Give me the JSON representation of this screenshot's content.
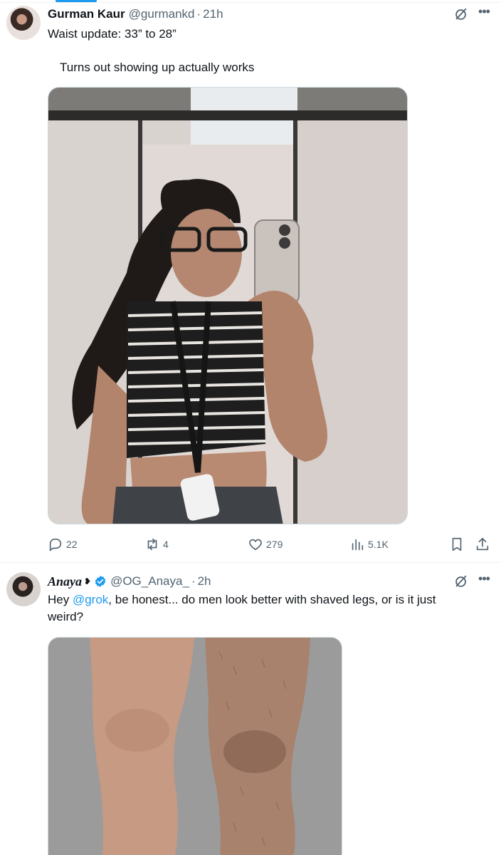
{
  "tweets": [
    {
      "author": {
        "name": "Gurman Kaur",
        "handle": "@gurmankd",
        "time": "21h"
      },
      "text_line_1": "Waist update: 33” to 28”",
      "text_line_2": "Turns out showing up actually works",
      "actions": {
        "replies": "22",
        "reposts": "4",
        "likes": "279",
        "views": "5.1K"
      }
    },
    {
      "author": {
        "name": "Anaya",
        "badge": "❥",
        "verified": true,
        "handle": "@OG_Anaya_",
        "time": "2h"
      },
      "text_prefix": "Hey ",
      "mention": "@grok",
      "text_suffix": ", be honest... do men look better with shaved legs, or is it just weird?"
    }
  ],
  "separator": "·",
  "more_glyph": "•••",
  "colors": {
    "accent": "#1d9bf0",
    "muted": "#536471",
    "text": "#0f1419",
    "border": "#eff3f4"
  },
  "icons": [
    "grok-icon",
    "more-icon",
    "reply-icon",
    "repost-icon",
    "like-icon",
    "views-icon",
    "bookmark-icon",
    "share-icon",
    "verified-icon"
  ]
}
